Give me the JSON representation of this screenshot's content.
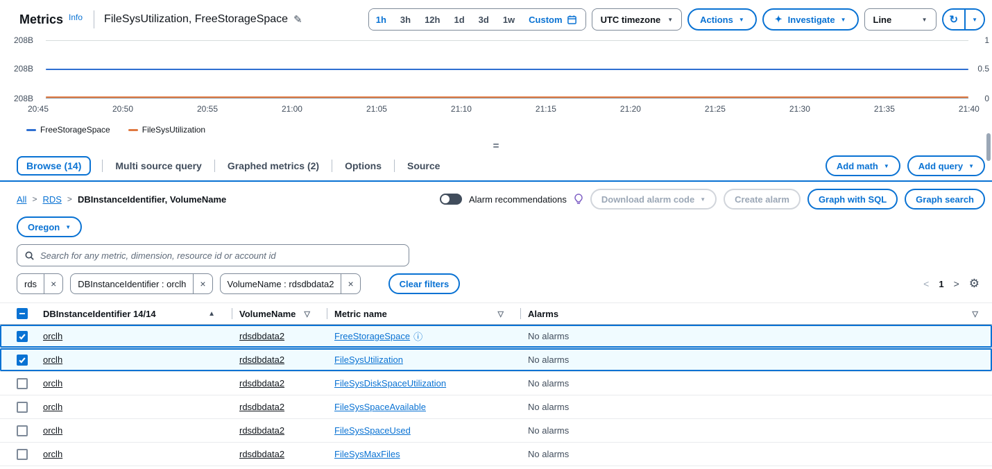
{
  "icons": {
    "caret_down": "▼",
    "sort_asc": "▲",
    "filter": "▽",
    "close": "×",
    "info": "ⓘ",
    "pencil": "✎",
    "gear": "⚙",
    "refresh": "↻",
    "sparkle": "✦",
    "page_prev": "<",
    "page_next": ">",
    "crumb_sep": ">",
    "handle": "="
  },
  "header": {
    "title": "Metrics",
    "info": "Info",
    "subtitle": "FileSysUtilization, FreeStorageSpace",
    "time_ranges": {
      "options": [
        "1h",
        "3h",
        "12h",
        "1d",
        "3d",
        "1w"
      ],
      "selected": "1h",
      "custom": "Custom"
    },
    "timezone": "UTC timezone",
    "actions": "Actions",
    "investigate": "Investigate",
    "chart_type": "Line"
  },
  "chart_data": {
    "type": "line",
    "title": "FileSysUtilization, FreeStorageSpace",
    "x": [
      "20:45",
      "20:50",
      "20:55",
      "21:00",
      "21:05",
      "21:10",
      "21:15",
      "21:20",
      "21:25",
      "21:30",
      "21:35",
      "21:40"
    ],
    "left_ticks": [
      "208B",
      "208B",
      "208B"
    ],
    "right_ticks": [
      "1",
      "0.5",
      "0"
    ],
    "left_ylim": [
      207.5,
      208.5
    ],
    "right_ylim": [
      0,
      1
    ],
    "grid": true,
    "legend_position": "bottom-left",
    "series": [
      {
        "name": "FreeStorageSpace",
        "axis": "left",
        "color": "#2e6fd1",
        "unit": "Bytes",
        "constant_value": 208,
        "values": [
          208,
          208,
          208,
          208,
          208,
          208,
          208,
          208,
          208,
          208,
          208,
          208
        ]
      },
      {
        "name": "FileSysUtilization",
        "axis": "right",
        "color": "#e07941",
        "constant_value": 0.02,
        "values": [
          0.02,
          0.02,
          0.02,
          0.02,
          0.02,
          0.02,
          0.02,
          0.02,
          0.02,
          0.02,
          0.02,
          0.02
        ]
      }
    ]
  },
  "tabs": {
    "items": [
      {
        "label": "Browse (14)",
        "active": true
      },
      {
        "label": "Multi source query",
        "active": false
      },
      {
        "label": "Graphed metrics (2)",
        "active": false
      },
      {
        "label": "Options",
        "active": false
      },
      {
        "label": "Source",
        "active": false
      }
    ],
    "add_math": "Add math",
    "add_query": "Add query"
  },
  "browse": {
    "breadcrumb": {
      "links": [
        "All",
        "RDS"
      ],
      "current": "DBInstanceIdentifier, VolumeName"
    },
    "alarm_recommendations": "Alarm recommendations",
    "download_alarm_code": "Download alarm code",
    "create_alarm": "Create alarm",
    "graph_with_sql": "Graph with SQL",
    "graph_search": "Graph search",
    "region": "Oregon",
    "search_placeholder": "Search for any metric, dimension, resource id or account id",
    "filters": [
      {
        "label": "rds"
      },
      {
        "label": "DBInstanceIdentifier : orclh"
      },
      {
        "label": "VolumeName : rdsdbdata2"
      }
    ],
    "clear_filters": "Clear filters",
    "page": "1"
  },
  "table": {
    "select_all_state": "indeterminate",
    "columns": [
      {
        "label": "DBInstanceIdentifier 14/14",
        "sort": "asc"
      },
      {
        "label": "VolumeName"
      },
      {
        "label": "Metric name"
      },
      {
        "label": "Alarms"
      }
    ],
    "rows": [
      {
        "selected": true,
        "checked": true,
        "db": "orclh",
        "volume": "rdsdbdata2",
        "metric": "FreeStorageSpace",
        "has_info": true,
        "alarms": "No alarms"
      },
      {
        "selected": true,
        "checked": true,
        "db": "orclh",
        "volume": "rdsdbdata2",
        "metric": "FileSysUtilization",
        "has_info": false,
        "alarms": "No alarms"
      },
      {
        "selected": false,
        "checked": false,
        "db": "orclh",
        "volume": "rdsdbdata2",
        "metric": "FileSysDiskSpaceUtilization",
        "has_info": false,
        "alarms": "No alarms"
      },
      {
        "selected": false,
        "checked": false,
        "db": "orclh",
        "volume": "rdsdbdata2",
        "metric": "FileSysSpaceAvailable",
        "has_info": false,
        "alarms": "No alarms"
      },
      {
        "selected": false,
        "checked": false,
        "db": "orclh",
        "volume": "rdsdbdata2",
        "metric": "FileSysSpaceUsed",
        "has_info": false,
        "alarms": "No alarms"
      },
      {
        "selected": false,
        "checked": false,
        "db": "orclh",
        "volume": "rdsdbdata2",
        "metric": "FileSysMaxFiles",
        "has_info": false,
        "alarms": "No alarms"
      }
    ]
  },
  "colors": {
    "accent": "#0972d3",
    "selected_row_bg": "#f0fbff",
    "chart_blue": "#2e6fd1",
    "chart_orange": "#e07941"
  }
}
